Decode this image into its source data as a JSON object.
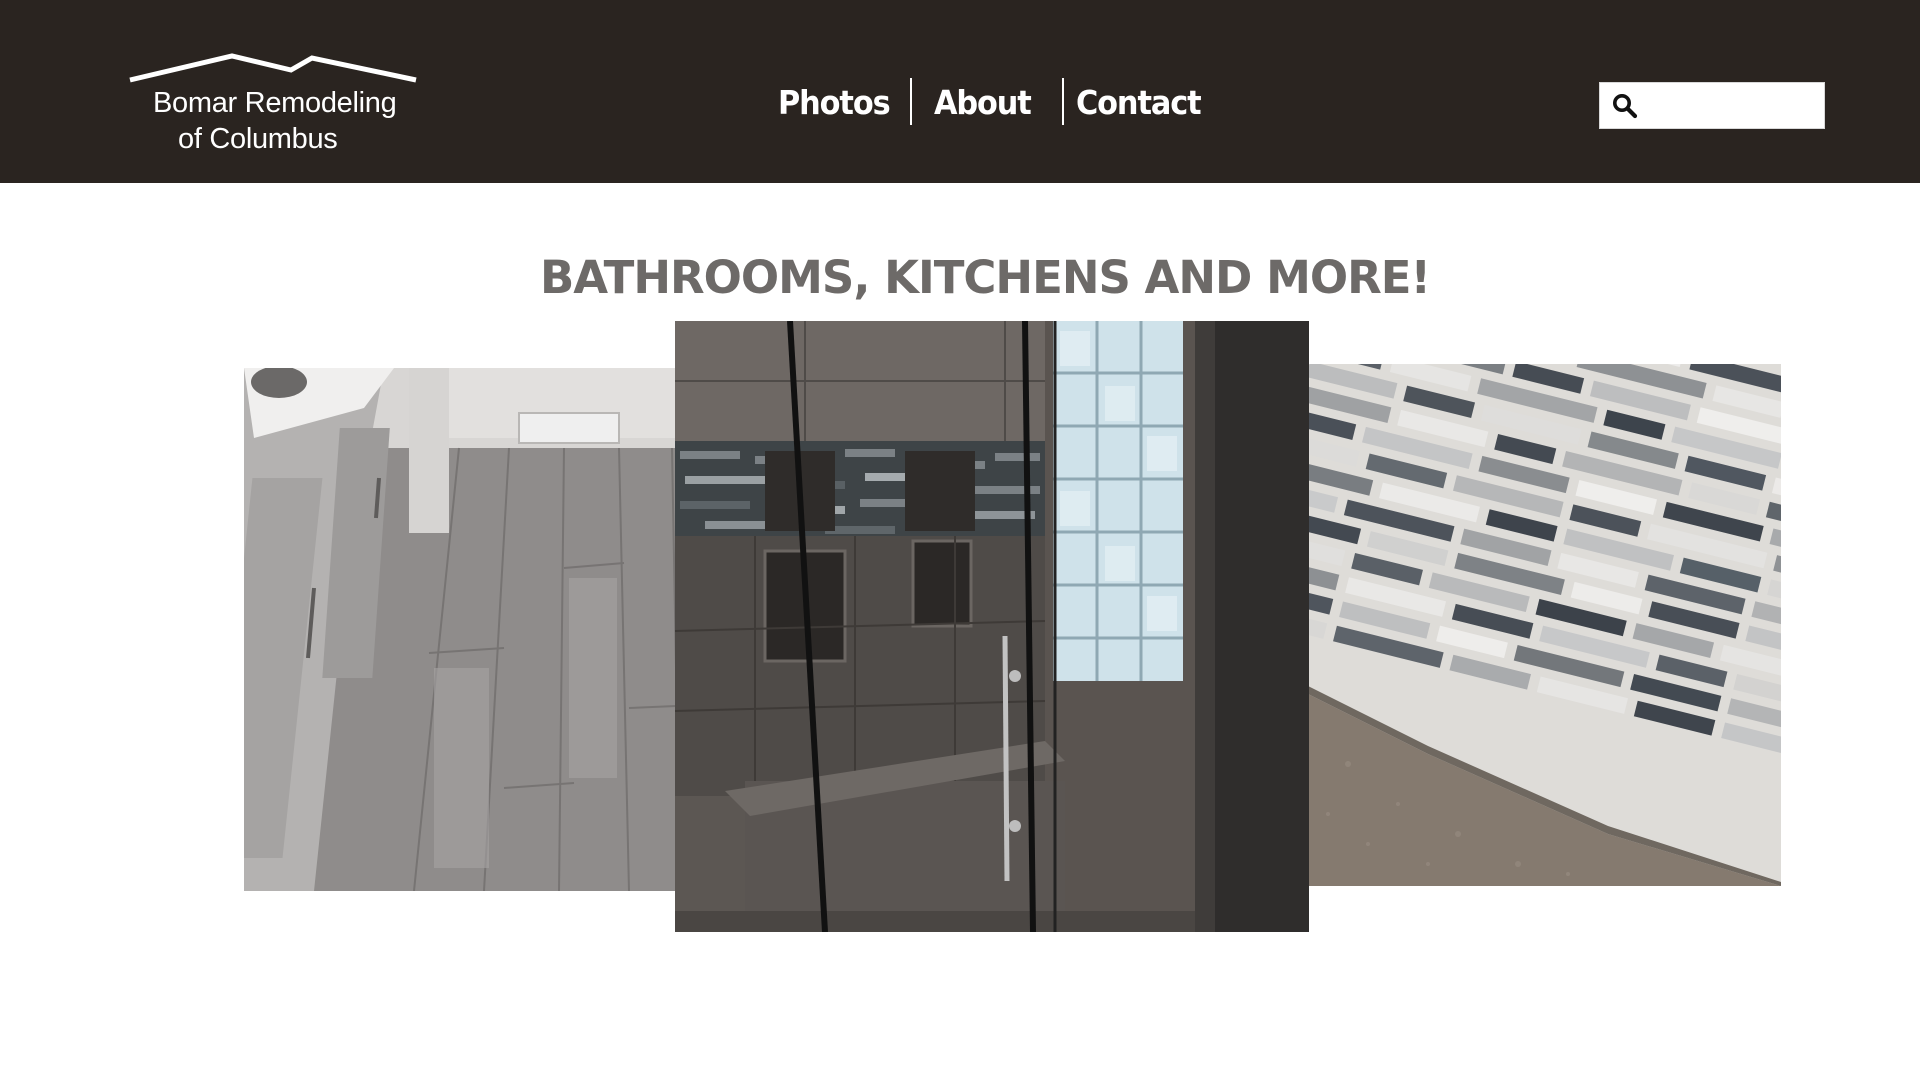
{
  "header": {
    "logo_line1": "Bomar Remodeling",
    "logo_line2": "of Columbus",
    "background": "#2a2420"
  },
  "nav": {
    "items": [
      {
        "label": "Photos"
      },
      {
        "label": "About"
      },
      {
        "label": "Contact"
      }
    ]
  },
  "search": {
    "placeholder": "",
    "icon": "search-icon"
  },
  "main": {
    "headline": "BATHROOMS, KITCHENS AND MORE!",
    "headline_color": "#6d6a68"
  },
  "gallery": {
    "images": [
      {
        "subject": "gray wood-look floor tile bathroom",
        "icon": "photo-floor"
      },
      {
        "subject": "glass walk-in shower with tiled bench and glass block window",
        "icon": "photo-shower"
      },
      {
        "subject": "glass mosaic tile backsplash over granite countertop",
        "icon": "photo-backsplash"
      }
    ]
  }
}
